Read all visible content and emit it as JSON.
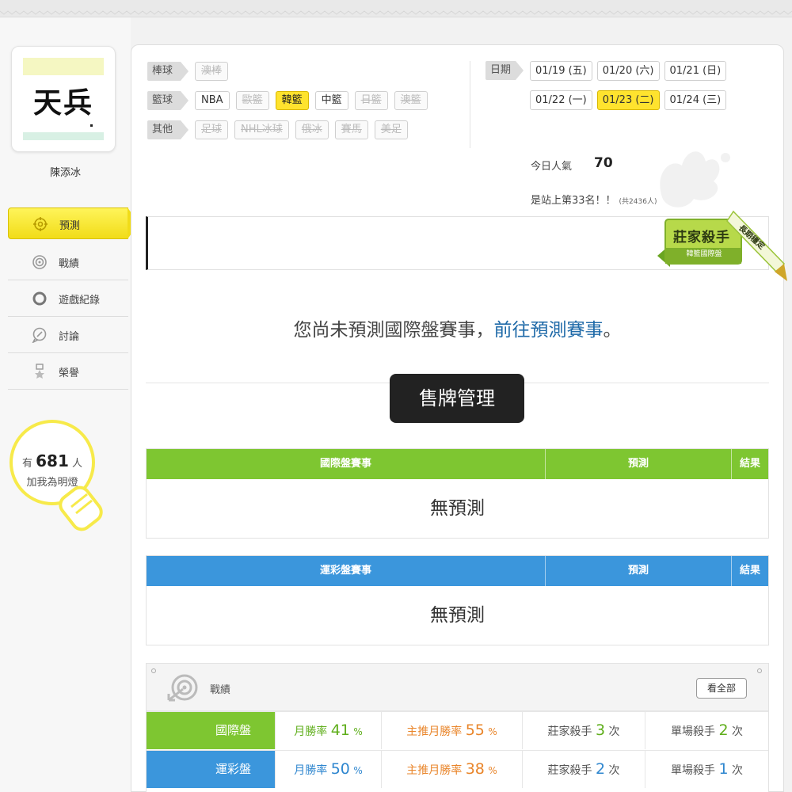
{
  "profile": {
    "logo_text": "天兵",
    "username": "陳添冰"
  },
  "nav": {
    "items": [
      {
        "label": "預測"
      },
      {
        "label": "戰績"
      },
      {
        "label": "遊戲紀錄"
      },
      {
        "label": "討論"
      },
      {
        "label": "榮譽"
      }
    ]
  },
  "fans": {
    "prefix": "有",
    "count": "681",
    "suffix": "人",
    "line2": "加我為明燈"
  },
  "filters": {
    "baseball": {
      "label": "棒球",
      "chips": [
        "澳棒"
      ]
    },
    "basketball": {
      "label": "籃球",
      "chips": [
        "NBA",
        "歐籃",
        "韓籃",
        "中籃",
        "日籃",
        "澳籃"
      ]
    },
    "other": {
      "label": "其他",
      "chips": [
        "足球",
        "NHL冰球",
        "俄冰",
        "賽馬",
        "美足"
      ]
    }
  },
  "dates": {
    "label": "日期",
    "row1": [
      "01/19 (五)",
      "01/20 (六)",
      "01/21 (日)"
    ],
    "row2": [
      "01/22 (一)",
      "01/23 (二)",
      "01/24 (三)"
    ],
    "selected": "01/23 (二)"
  },
  "stats": {
    "popularity_label": "今日人氣",
    "popularity_value": "70",
    "rank_text": "是站上第33名！！",
    "rank_total": "(共2436人)"
  },
  "badge": {
    "title": "莊家殺手",
    "sub": "韓籃國際盤",
    "side": "長期穩定"
  },
  "message": {
    "text": "您尚未預測國際盤賽事，",
    "link": "前往預測賽事",
    "end": "。"
  },
  "sell_button": "售牌管理",
  "intl_table": {
    "headers": [
      "國際盤賽事",
      "預測",
      "結果"
    ],
    "empty": "無預測"
  },
  "lottery_table": {
    "headers": [
      "運彩盤賽事",
      "預測",
      "結果"
    ],
    "empty": "無預測"
  },
  "record": {
    "title": "戰績",
    "see_all": "看全部",
    "rows": [
      {
        "label": "國際盤",
        "monthly_label": "月勝率",
        "monthly_value": "41",
        "monthly_unit": "%",
        "main_label": "主推月勝率",
        "main_value": "55",
        "main_unit": "%",
        "dealer_label": "莊家殺手",
        "dealer_value": "3",
        "dealer_unit": "次",
        "single_label": "單場殺手",
        "single_value": "2",
        "single_unit": "次"
      },
      {
        "label": "運彩盤",
        "monthly_label": "月勝率",
        "monthly_value": "50",
        "monthly_unit": "%",
        "main_label": "主推月勝率",
        "main_value": "38",
        "main_unit": "%",
        "dealer_label": "莊家殺手",
        "dealer_value": "2",
        "dealer_unit": "次",
        "single_label": "單場殺手",
        "single_value": "1",
        "single_unit": "次"
      }
    ]
  },
  "colors": {
    "intl_green": "#7ec631",
    "lottery_blue": "#3b96dc",
    "highlight_yellow": "#ffe32e"
  }
}
